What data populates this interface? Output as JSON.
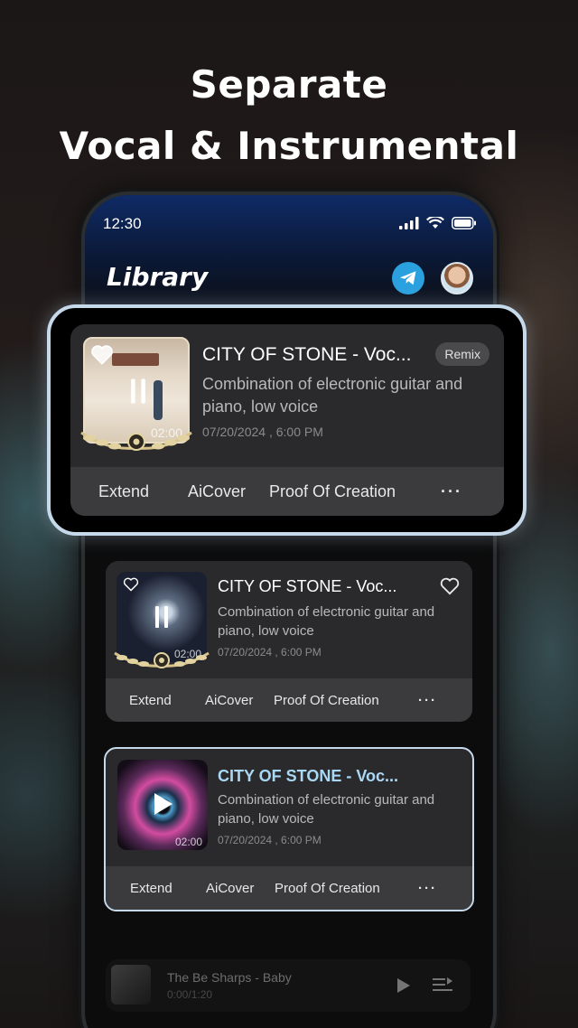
{
  "headline": {
    "line1": "Separate",
    "line2": "Vocal & Instrumental"
  },
  "status_bar": {
    "time": "12:30"
  },
  "header": {
    "title": "Library"
  },
  "featured": {
    "title": "CITY OF STONE  - Voc...",
    "badge": "Remix",
    "description": "Combination of electronic guitar and piano, low voice",
    "date": "07/20/2024 , 6:00 PM",
    "duration": "02:00",
    "actions": {
      "extend": "Extend",
      "aicover": "AiCover",
      "proof": "Proof Of Creation",
      "more": "···"
    }
  },
  "tracks": [
    {
      "title": "CITY OF STONE  - Voc...",
      "description": "Combination of electronic guitar and piano, low voice",
      "date": "07/20/2024 , 6:00 PM",
      "duration": "02:00",
      "actions": {
        "extend": "Extend",
        "aicover": "AiCover",
        "proof": "Proof Of Creation",
        "more": "···"
      }
    },
    {
      "title": "CITY OF STONE  - Voc...",
      "description": "Combination of electronic guitar and piano, low voice",
      "date": "07/20/2024 , 6:00 PM",
      "duration": "02:00",
      "actions": {
        "extend": "Extend",
        "aicover": "AiCover",
        "proof": "Proof Of Creation",
        "more": "···"
      }
    }
  ],
  "mini_player": {
    "title": "The Be Sharps - Baby",
    "subtitle": "0:00/1:20"
  },
  "colors": {
    "accent_title": "#a9d8f5",
    "telegram": "#2aa1de",
    "selected_border": "#c6d9ea"
  }
}
